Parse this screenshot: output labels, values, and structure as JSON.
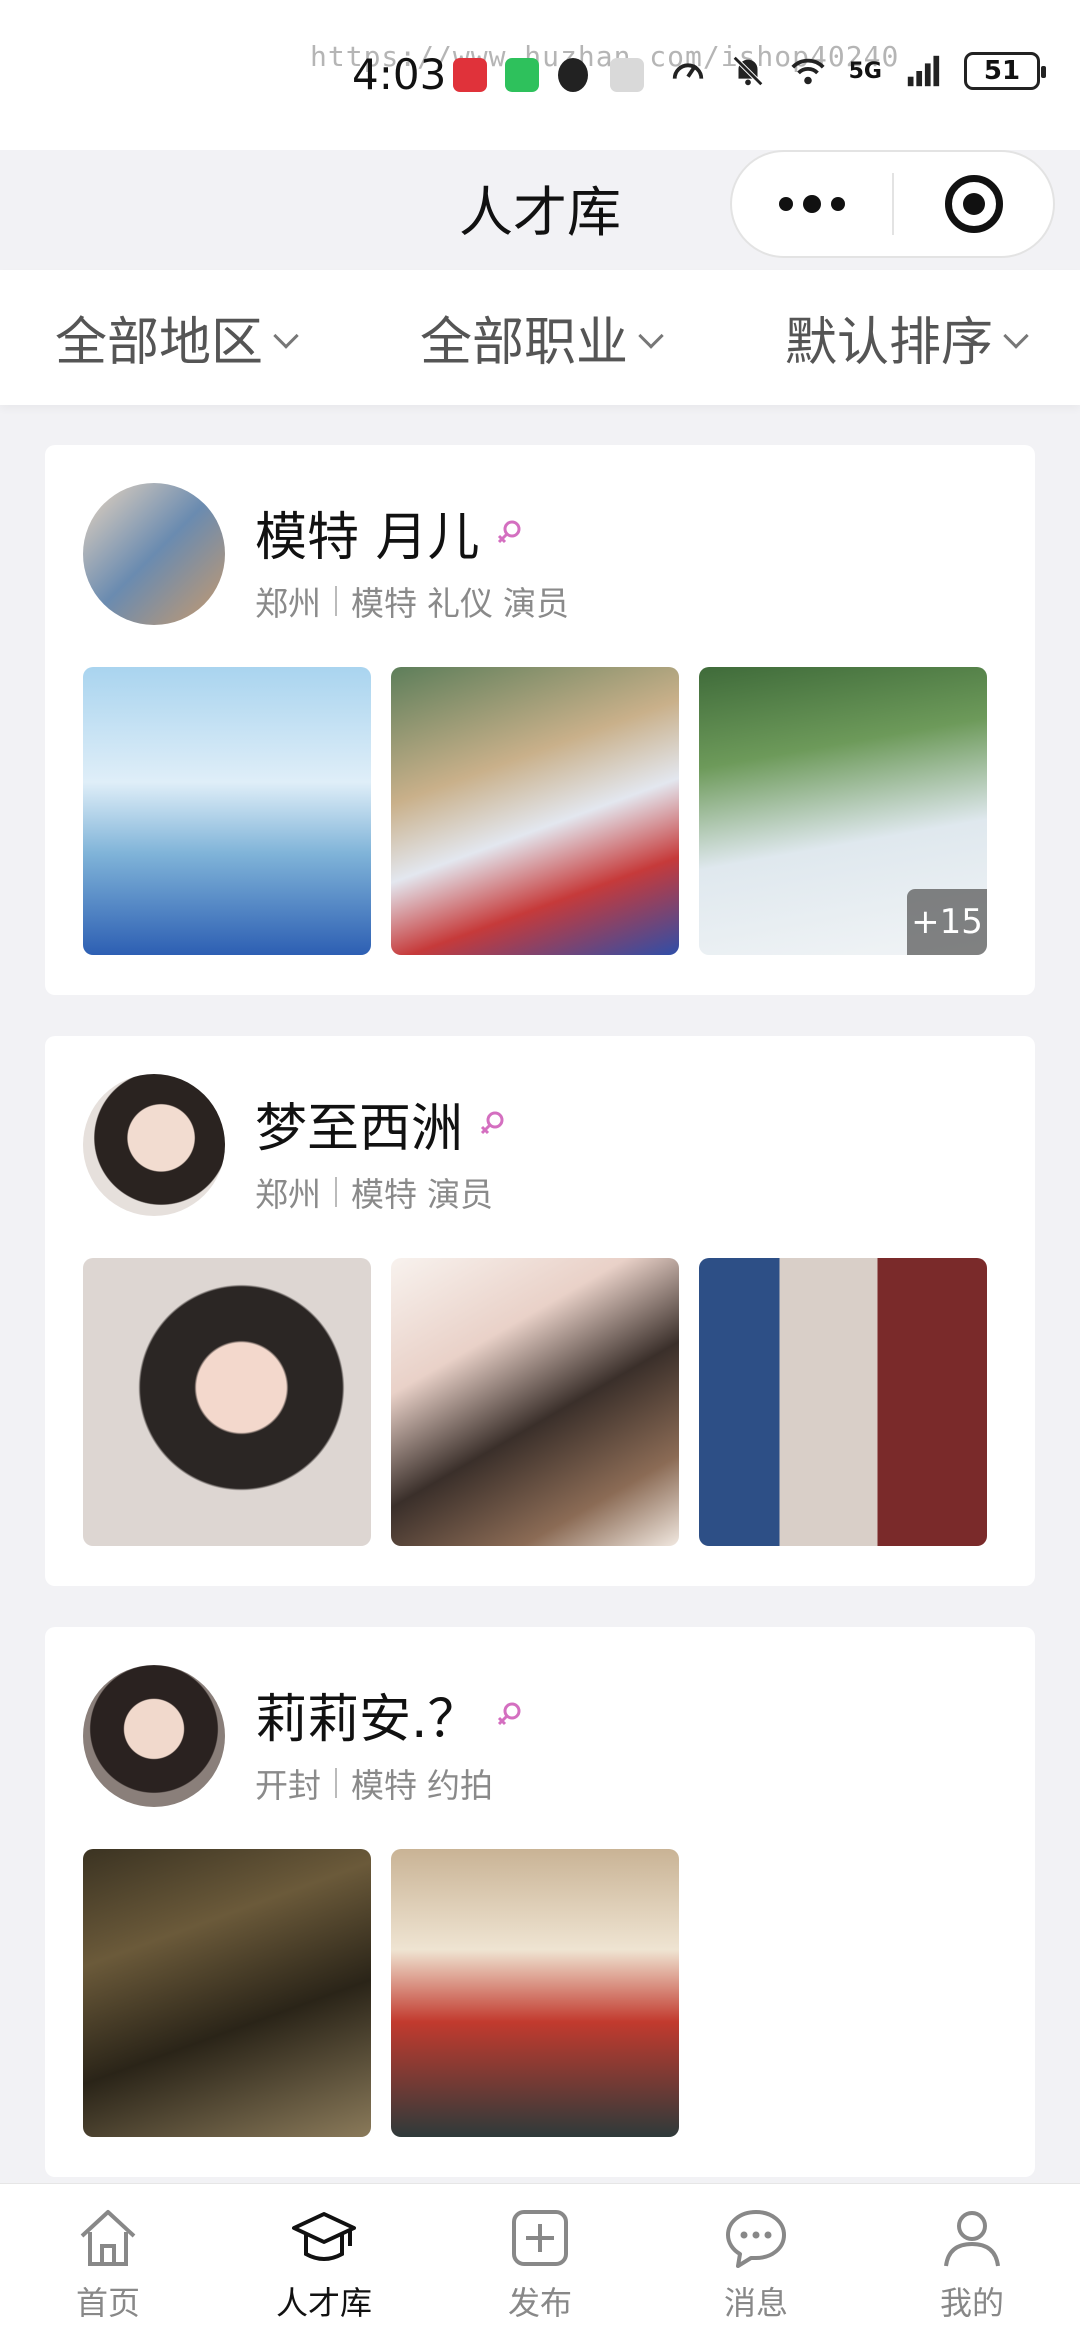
{
  "status_bar": {
    "time": "4:03",
    "watermark": "https://www.huzhan.com/ishop40240",
    "network": "5G",
    "battery": "51"
  },
  "header": {
    "title": "人才库"
  },
  "filters": [
    {
      "label": "全部地区"
    },
    {
      "label": "全部职业"
    },
    {
      "label": "默认排序"
    }
  ],
  "talents": [
    {
      "name": "模特 月儿",
      "city": "郑州",
      "tags": [
        "模特",
        "礼仪",
        "演员"
      ],
      "photo_count_more": "+15"
    },
    {
      "name": "梦至西洲",
      "city": "郑州",
      "tags": [
        "模特",
        "演员"
      ]
    },
    {
      "name": "莉莉安.？",
      "city": "开封",
      "tags": [
        "模特",
        "约拍"
      ]
    }
  ],
  "tab_bar": {
    "items": [
      {
        "label": "首页",
        "icon": "home-icon"
      },
      {
        "label": "人才库",
        "icon": "graduation-cap-icon"
      },
      {
        "label": "发布",
        "icon": "plus-square-icon"
      },
      {
        "label": "消息",
        "icon": "chat-bubble-icon"
      },
      {
        "label": "我的",
        "icon": "user-icon"
      }
    ],
    "active": "人才库"
  },
  "colors": {
    "female_icon": "#d46fc0",
    "background": "#f2f2f5"
  }
}
